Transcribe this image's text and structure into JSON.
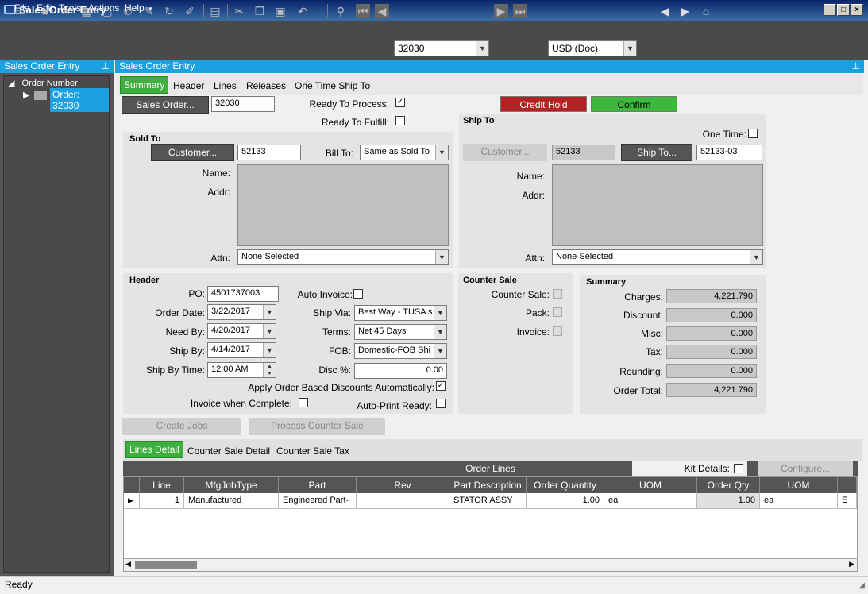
{
  "window": {
    "title": "Sales Order Entry"
  },
  "menu": [
    "File",
    "Edit",
    "Tools",
    "Actions",
    "Help"
  ],
  "toolbar": {
    "order_value": "32030",
    "currency_value": "USD (Doc)"
  },
  "left_panel": {
    "title": "Sales Order Entry",
    "tree_root": "Order Number",
    "tree_item": "Order: 32030"
  },
  "main": {
    "title": "Sales Order Entry",
    "tabs": [
      "Summary",
      "Header",
      "Lines",
      "Releases",
      "One Time Ship To"
    ],
    "sales_order_label": "Sales Order...",
    "sales_order_value": "32030",
    "ready_to_process_label": "Ready To Process:",
    "ready_to_fulfill_label": "Ready To Fulfill:",
    "credit_hold_label": "Credit Hold",
    "confirm_label": "Confirm",
    "check_mark": "✓"
  },
  "sold_to": {
    "title": "Sold To",
    "customer_btn": "Customer...",
    "customer_value": "52133",
    "bill_to_label": "Bill To:",
    "bill_to_value": "Same as Sold To",
    "name_label": "Name:",
    "addr_label": "Addr:",
    "attn_label": "Attn:",
    "attn_value": "None Selected"
  },
  "ship_to": {
    "title": "Ship To",
    "one_time_label": "One Time:",
    "customer_btn": "Customer...",
    "customer_value": "52133",
    "ship_to_btn": "Ship To...",
    "ship_to_value": "52133-03",
    "name_label": "Name:",
    "addr_label": "Addr:",
    "attn_label": "Attn:",
    "attn_value": "None Selected"
  },
  "header": {
    "title": "Header",
    "po_label": "PO:",
    "po_value": "4501737003",
    "order_date_label": "Order Date:",
    "order_date_value": "3/22/2017",
    "need_by_label": "Need By:",
    "need_by_value": "4/20/2017",
    "ship_by_label": "Ship By:",
    "ship_by_value": "4/14/2017",
    "ship_by_time_label": "Ship By Time:",
    "ship_by_time_value": "12:00 AM",
    "auto_invoice_label": "Auto Invoice:",
    "ship_via_label": "Ship Via:",
    "ship_via_value": "Best Way - TUSA s",
    "terms_label": "Terms:",
    "terms_value": "Net 45 Days",
    "fob_label": "FOB:",
    "fob_value": "Domestic-FOB Shi",
    "disc_label": "Disc %:",
    "disc_value": "0.00",
    "apply_discounts_label": "Apply Order Based Discounts Automatically:",
    "invoice_complete_label": "Invoice when Complete:",
    "auto_print_label": "Auto-Print Ready:"
  },
  "counter_sale": {
    "title": "Counter Sale",
    "counter_sale_label": "Counter Sale:",
    "pack_label": "Pack:",
    "invoice_label": "Invoice:"
  },
  "summary": {
    "title": "Summary",
    "rows": [
      {
        "label": "Charges:",
        "value": "4,221.790"
      },
      {
        "label": "Discount:",
        "value": "0.000"
      },
      {
        "label": "Misc:",
        "value": "0.000"
      },
      {
        "label": "Tax:",
        "value": "0.000"
      },
      {
        "label": "Rounding:",
        "value": "0.000"
      },
      {
        "label": "Order Total:",
        "value": "4,221.790"
      }
    ]
  },
  "actions": {
    "create_jobs": "Create Jobs",
    "process_counter_sale": "Process Counter Sale"
  },
  "lines": {
    "tabs": [
      "Lines Detail",
      "Counter Sale Detail",
      "Counter Sale Tax"
    ],
    "title": "Order Lines",
    "kit_details_label": "Kit Details:",
    "configure_label": "Configure...",
    "columns": [
      "Line",
      "MfgJobType",
      "Part",
      "Rev",
      "Part Description",
      "Order Quantity",
      "UOM",
      "Order Qty",
      "UOM"
    ],
    "row": {
      "line": "1",
      "type": "Manufactured",
      "part": "Engineered Part-",
      "rev": "",
      "desc": "STATOR ASSY",
      "qty": "1.00",
      "uom": "ea",
      "oqty": "1.00",
      "ouom": "ea",
      "extra": "E"
    }
  },
  "status": {
    "text": "Ready"
  }
}
